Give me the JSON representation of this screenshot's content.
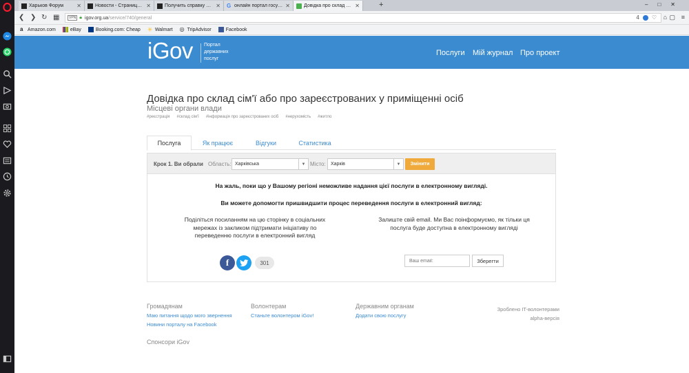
{
  "browser": {
    "tabs": [
      {
        "title": "Харьков Форум",
        "active": false
      },
      {
        "title": "Новости - Страница 2 - Х",
        "active": false
      },
      {
        "title": "Получить справку о соста",
        "active": false
      },
      {
        "title": "онлайн портал госуслуг у",
        "active": false
      },
      {
        "title": "Довідка про склад сім'ї а",
        "active": true
      }
    ],
    "new_tab": "+",
    "url_host": "igov.org.ua",
    "url_path": "/service/740/general",
    "vpn": "VPN",
    "url_badge": "4",
    "bookmarks": [
      {
        "label": "Amazon.com",
        "icon": "amazon-icon"
      },
      {
        "label": "eBay",
        "icon": "ebay-icon"
      },
      {
        "label": "Booking.com: Cheap",
        "icon": "booking-icon"
      },
      {
        "label": "Walmart",
        "icon": "walmart-icon"
      },
      {
        "label": "TripAdvisor",
        "icon": "tripadvisor-icon"
      },
      {
        "label": "Facebook",
        "icon": "facebook-icon"
      }
    ]
  },
  "site": {
    "logo": "iGov",
    "portal_line1": "Портал",
    "portal_line2": "державних",
    "portal_line3": "послуг",
    "nav": [
      "Послуги",
      "Мій журнал",
      "Про проект"
    ],
    "brand_color": "#3b8bd1"
  },
  "service": {
    "title": "Довідка про склад сім'ї або про зареєстрованих у приміщенні осіб",
    "subtitle": "Місцеві органи влади",
    "tags": [
      "#реєстрація",
      "#склад сім'ї",
      "#інформація про зареєстрованих осіб",
      "#нерухомість",
      "#житло"
    ]
  },
  "tabs": [
    "Послуга",
    "Як працює",
    "Відгуки",
    "Статистика"
  ],
  "step": {
    "label": "Крок 1. Ви обрали",
    "region_label": "Область:",
    "region_value": "Харківська",
    "city_label": "Місто:",
    "city_value": "Харків",
    "change_button": "Змінити"
  },
  "messages": {
    "unavailable": "На жаль, поки що у Вашому регіоні неможливе надання цієї послуги в електронному вигляді.",
    "help": "Ви можете допомогти пришвидшити процес переведення послуги в електронний вигляд:",
    "share": "Поділіться посиланням на цю сторінку в соціальних мережах із закликом підтримати ініціативу по переведенню послуги в електронний вигляд",
    "email": "Залиште свій email. Ми Вас поінформуємо, як тільки ця послуга буде доступна в електронному вигляді",
    "share_count": "301",
    "email_placeholder": "Ваш email:",
    "save_button": "Зберегти"
  },
  "footer": {
    "col1_title": "Громадянам",
    "col1_links": [
      "Маю питання щодо мого звернення",
      "Новини порталу на Facebook"
    ],
    "col2_title": "Волонтерам",
    "col2_links": [
      "Станьте волонтером iGov!"
    ],
    "col3_title": "Державним органам",
    "col3_links": [
      "Додати свою послугу"
    ],
    "made_by": "Зроблено IT-волонтерами",
    "version": "alpha-версія",
    "sponsors": "Спонсори iGov"
  }
}
